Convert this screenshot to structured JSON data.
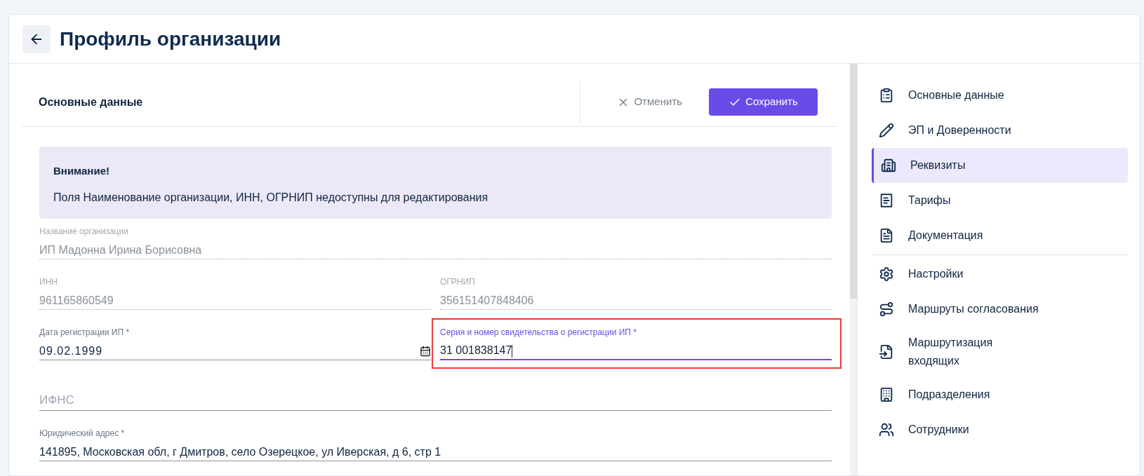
{
  "page": {
    "title": "Профиль организации"
  },
  "section": {
    "title": "Основные данные",
    "cancel": "Отменить",
    "save": "Сохранить"
  },
  "notice": {
    "title": "Внимание!",
    "text": "Поля Наименование организации, ИНН, ОГРНИП недоступны для редактирования"
  },
  "form_rows": [
    [
      {
        "kind": "text",
        "label": "Название организации",
        "value": "ИП Мадонна Ирина Борисовна",
        "disabled": true,
        "focused": false
      }
    ],
    [
      {
        "kind": "text",
        "label": "ИНН",
        "value": "961165860549",
        "disabled": true,
        "focused": false
      },
      {
        "kind": "text",
        "label": "ОГРНИП",
        "value": "356151407848406",
        "disabled": true,
        "focused": false
      }
    ],
    [
      {
        "kind": "date",
        "label": "Дата регистрации ИП *",
        "value": "09.02.1999",
        "disabled": false,
        "focused": false
      },
      {
        "kind": "text",
        "label": "Серия и номер свидетельства о регистрации ИП *",
        "value": "31 001838147",
        "disabled": false,
        "focused": true,
        "highlighted": true
      }
    ],
    [
      {
        "kind": "select",
        "placeholder": "ИФНС",
        "disabled": false,
        "focused": false
      }
    ],
    [
      {
        "kind": "text",
        "label": "Юридический адрес *",
        "value": "141895, Московская обл, г Дмитров, село Озерецкое, ул Иверская, д 6, стр 1",
        "disabled": false,
        "focused": false
      }
    ]
  ],
  "sidebar": {
    "groups": [
      [
        {
          "kind": "clipboard",
          "label": "Основные данные",
          "selected": false
        },
        {
          "kind": "pen",
          "label": "ЭП и Доверенности",
          "selected": false
        },
        {
          "kind": "building",
          "label": "Реквизиты",
          "selected": true
        },
        {
          "kind": "tariff",
          "label": "Тарифы",
          "selected": false
        },
        {
          "kind": "document",
          "label": "Документация",
          "selected": false
        }
      ],
      [
        {
          "kind": "gear",
          "label": "Настройки",
          "selected": false
        },
        {
          "kind": "route",
          "label": "Маршруты согласования",
          "selected": false
        },
        {
          "kind": "inbox",
          "label": "Маршрутизация входящих",
          "selected": false
        },
        {
          "kind": "office",
          "label": "Подразделения",
          "selected": false
        },
        {
          "kind": "people",
          "label": "Сотрудники",
          "selected": false
        }
      ]
    ]
  }
}
